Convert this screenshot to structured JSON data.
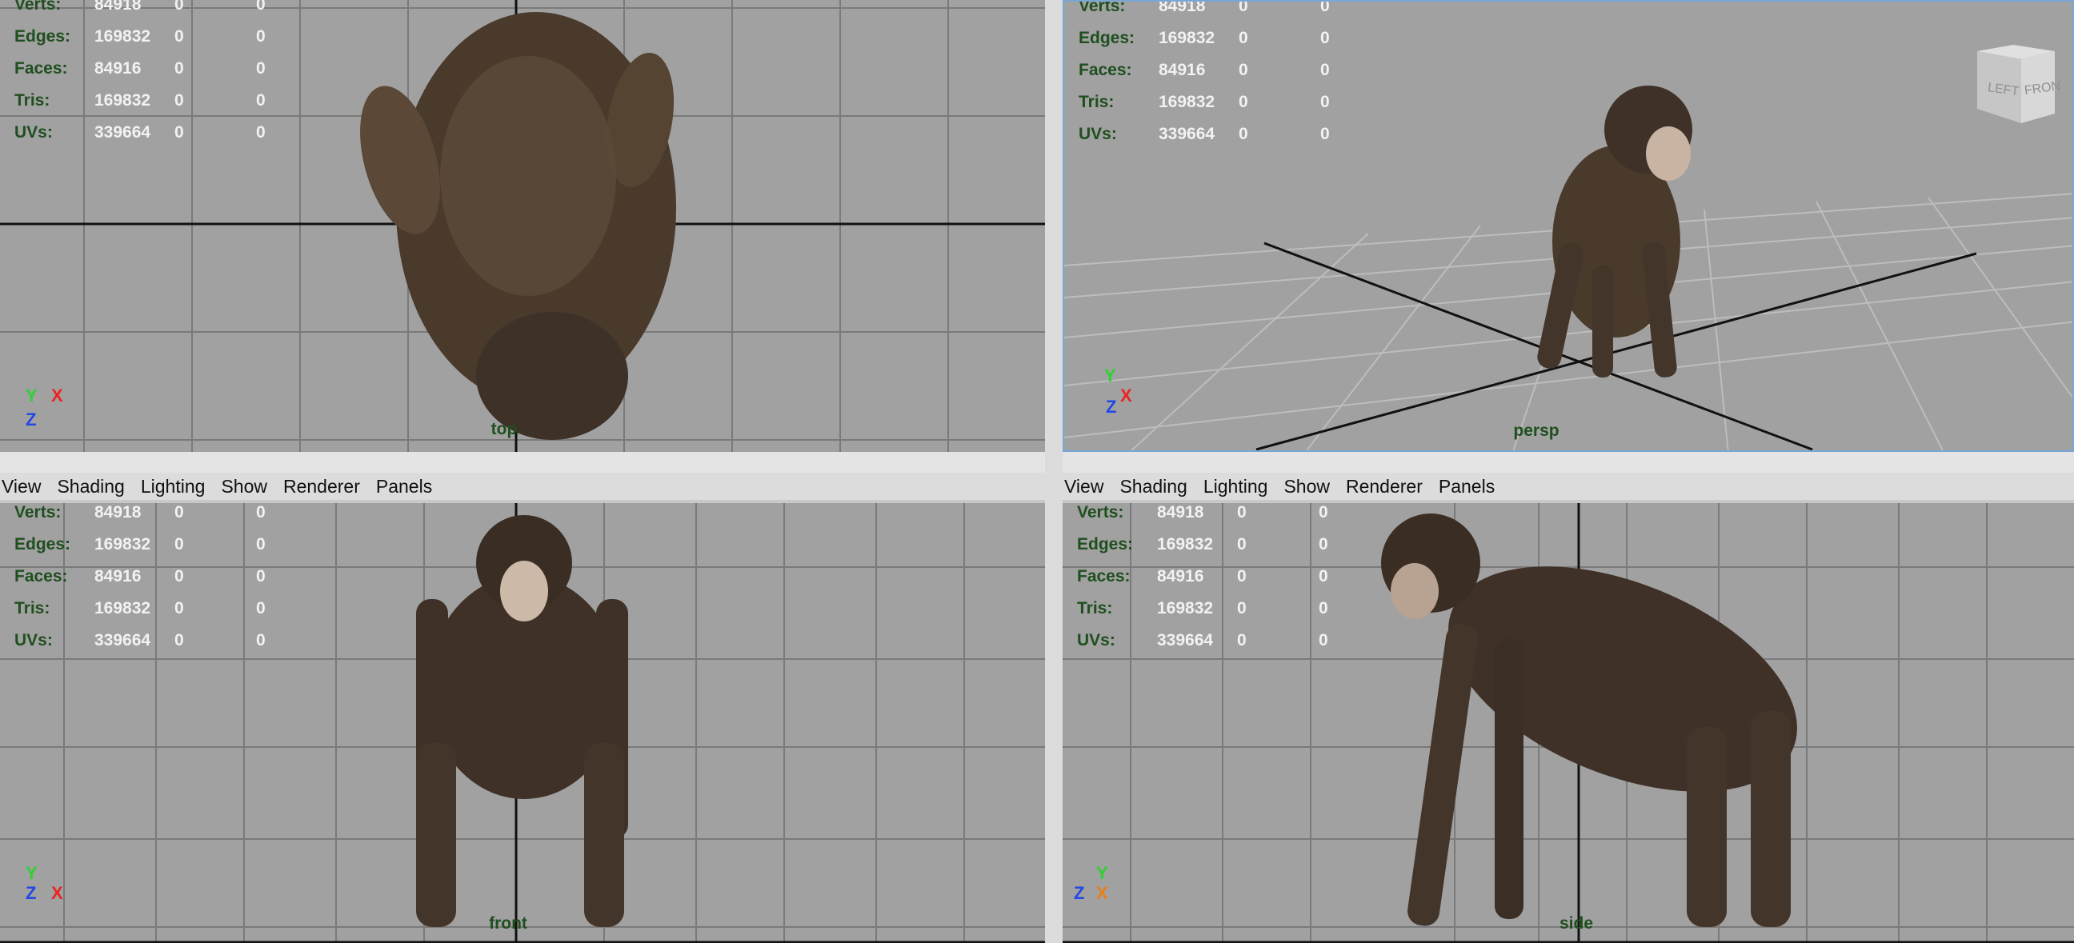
{
  "stats": [
    {
      "label": "Verts:",
      "values": [
        "84918",
        "0",
        "0"
      ]
    },
    {
      "label": "Edges:",
      "values": [
        "169832",
        "0",
        "0"
      ]
    },
    {
      "label": "Faces:",
      "values": [
        "84916",
        "0",
        "0"
      ]
    },
    {
      "label": "Tris:",
      "values": [
        "169832",
        "0",
        "0"
      ]
    },
    {
      "label": "UVs:",
      "values": [
        "339664",
        "0",
        "0"
      ]
    }
  ],
  "menu": [
    "View",
    "Shading",
    "Lighting",
    "Show",
    "Renderer",
    "Panels"
  ],
  "views": {
    "top": {
      "camera": "top"
    },
    "persp": {
      "camera": "persp"
    },
    "front": {
      "camera": "front"
    },
    "side": {
      "camera": "side"
    }
  },
  "axes": {
    "x": "X",
    "y": "Y",
    "z": "Z"
  },
  "viewcube": {
    "left": "LEFT",
    "front": "FRONT"
  },
  "colors": {
    "viewport_bg": "#a1a1a1",
    "grid": "#7a7a7a",
    "axis_line": "#111111",
    "active_border": "#7aa6d6",
    "hud_label": "#1f4f1f",
    "hud_value": "#f2f2f2"
  }
}
